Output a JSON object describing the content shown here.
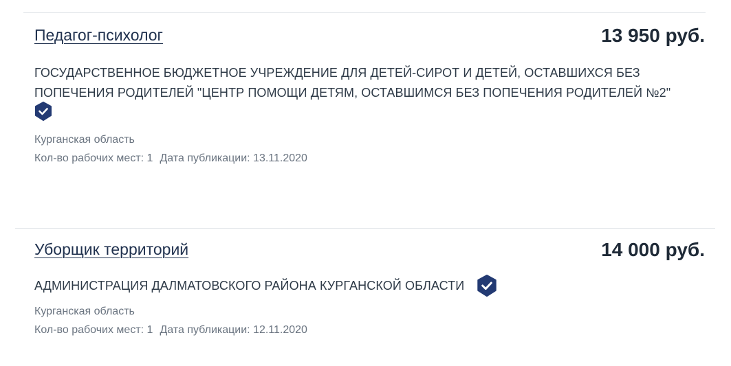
{
  "vacancies": [
    {
      "title": "Педагог-психолог",
      "salary": "13 950 руб.",
      "employer": "ГОСУДАРСТВЕННОЕ БЮДЖЕТНОЕ УЧРЕЖДЕНИЕ ДЛЯ ДЕТЕЙ-СИРОТ И ДЕТЕЙ, ОСТАВШИХСЯ БЕЗ ПОПЕЧЕНИЯ РОДИТЕЛЕЙ \"ЦЕНТР ПОМОЩИ ДЕТЯМ, ОСТАВШИМСЯ БЕЗ ПОПЕЧЕНИЯ РОДИТЕЛЕЙ №2\"",
      "verified_icon": "verified-check-icon",
      "region": "Курганская область",
      "workplaces": "Кол-во рабочих мест: 1",
      "published": "Дата публикации: 13.11.2020"
    },
    {
      "title": "Уборщик территорий",
      "salary": "14 000 руб.",
      "employer": "АДМИНИСТРАЦИЯ ДАЛМАТОВСКОГО РАЙОНА КУРГАНСКОЙ ОБЛАСТИ",
      "verified_icon": "verified-check-icon",
      "region": "Курганская область",
      "workplaces": "Кол-во рабочих мест: 1",
      "published": "Дата публикации: 12.11.2020"
    }
  ],
  "colors": {
    "badge": "#233a73",
    "title": "#21324f",
    "meta": "#6a7480",
    "divider": "#e3e6ea"
  }
}
